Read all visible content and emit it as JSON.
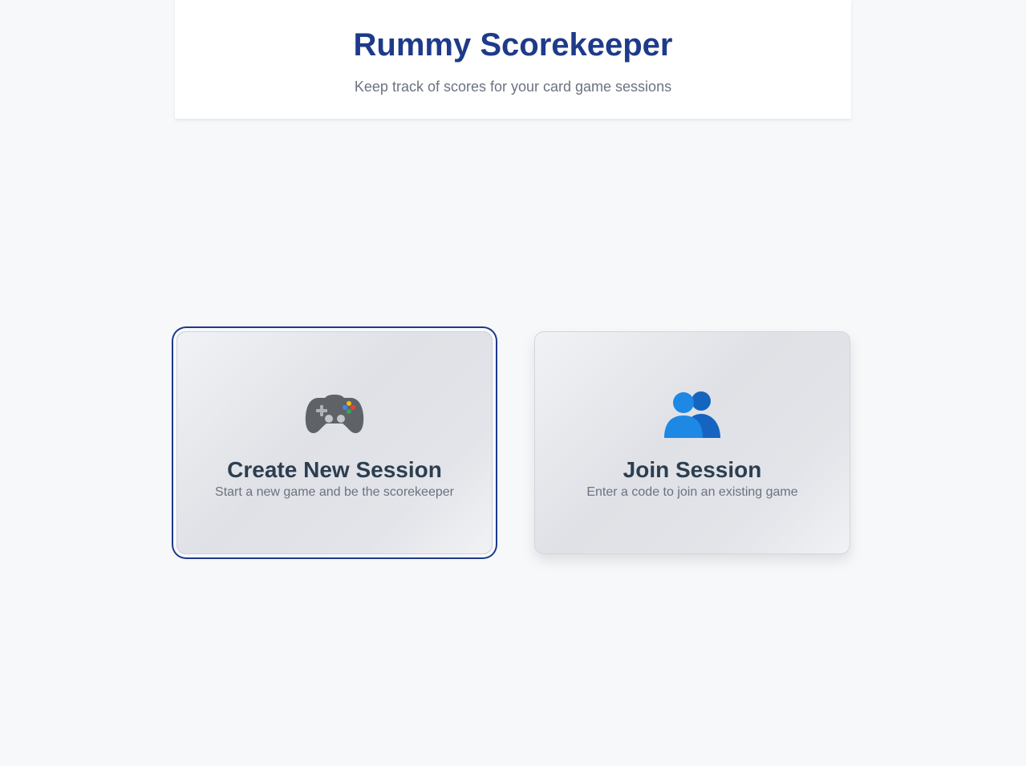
{
  "header": {
    "title": "Rummy Scorekeeper",
    "subtitle": "Keep track of scores for your card game sessions"
  },
  "cards": [
    {
      "icon": "gamepad-icon",
      "title": "Create New Session",
      "description": "Start a new game and be the scorekeeper",
      "focused": true
    },
    {
      "icon": "users-icon",
      "title": "Join Session",
      "description": "Enter a code to join an existing game",
      "focused": false
    }
  ],
  "colors": {
    "brand": "#1e3a8a",
    "background": "#f7f8fa",
    "card_title": "#2c3e50",
    "muted_text": "#6b7280",
    "users_icon": "#1e73c8"
  }
}
